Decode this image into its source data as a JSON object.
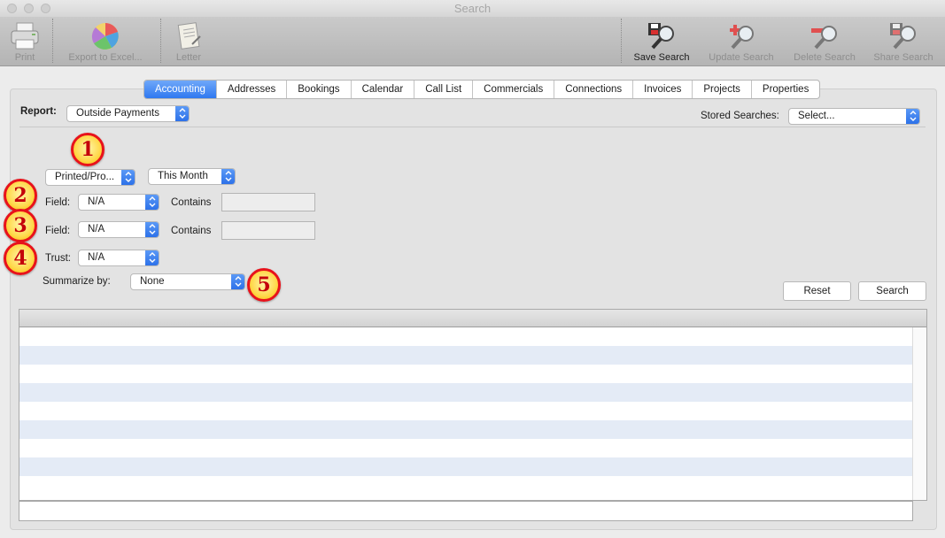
{
  "window": {
    "title": "Search"
  },
  "toolbar": {
    "print": "Print",
    "export": "Export to Excel...",
    "letter": "Letter",
    "save": "Save Search",
    "update": "Update Search",
    "delete": "Delete Search",
    "share": "Share Search"
  },
  "tabs": [
    "Accounting",
    "Addresses",
    "Bookings",
    "Calendar",
    "Call List",
    "Commercials",
    "Connections",
    "Invoices",
    "Projects",
    "Properties"
  ],
  "report": {
    "label": "Report:",
    "value": "Outside Payments"
  },
  "stored": {
    "label": "Stored Searches:",
    "value": "Select..."
  },
  "filters": {
    "date_type": "Printed/Pro...",
    "date_range": "This Month",
    "field1_label": "Field:",
    "field1_value": "N/A",
    "contains1": "Contains",
    "contains1_value": "",
    "field2_label": "Field:",
    "field2_value": "N/A",
    "contains2": "Contains",
    "contains2_value": "",
    "trust_label": "Trust:",
    "trust_value": "N/A",
    "summarize_label": "Summarize by:",
    "summarize_value": "None"
  },
  "buttons": {
    "reset": "Reset",
    "search": "Search"
  },
  "badges": [
    "1",
    "2",
    "3",
    "4",
    "5"
  ],
  "colors": {
    "accent": "#2f78f0",
    "badge_ring": "#e8121b",
    "badge_fill": "#ffd84a",
    "row_alt": "#e4ebf6"
  }
}
